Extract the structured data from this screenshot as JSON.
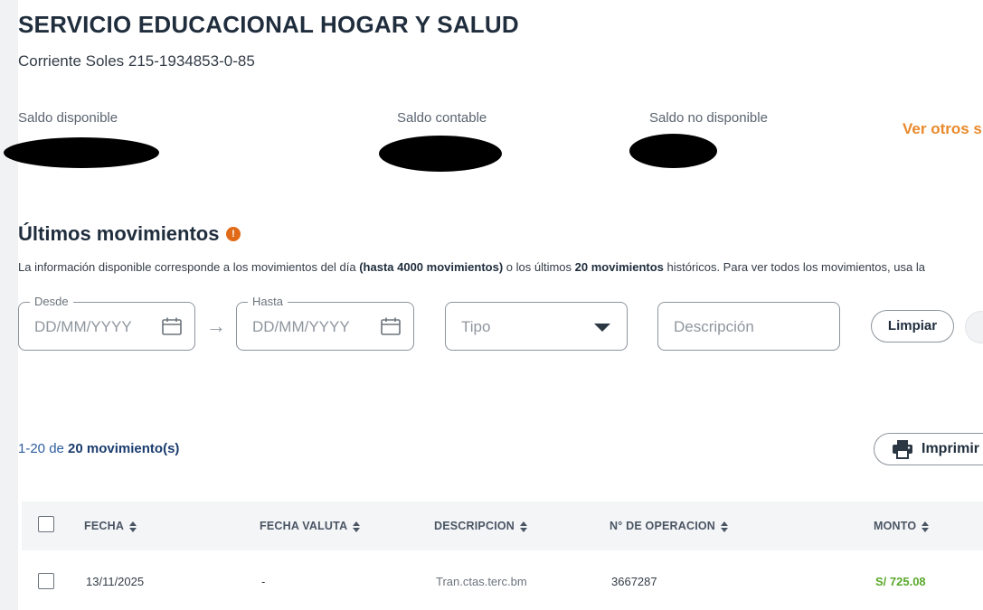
{
  "header": {
    "title": "SERVICIO EDUCACIONAL HOGAR Y SALUD",
    "account": "Corriente Soles 215-1934853-0-85"
  },
  "balances": {
    "available_label": "Saldo disponible",
    "accounting_label": "Saldo contable",
    "unavailable_label": "Saldo no disponible",
    "see_others": "Ver otros s"
  },
  "movements": {
    "title": "Últimos movimientos",
    "info_icon": "!",
    "info_text": {
      "part1": "La información disponible corresponde a los movimientos del día ",
      "bold1": "(hasta 4000 movimientos)",
      "part2": " o los últimos ",
      "bold2": "20 movimientos",
      "part3": " históricos. Para ver todos los movimientos, usa la"
    }
  },
  "filters": {
    "from_label": "Desde",
    "from_placeholder": "DD/MM/YYYY",
    "to_label": "Hasta",
    "to_placeholder": "DD/MM/YYYY",
    "arrow": "→",
    "type_placeholder": "Tipo",
    "description_placeholder": "Descripción",
    "clear_label": "Limpiar"
  },
  "results": {
    "range": "1-20 de ",
    "count": "20 movimiento(s)",
    "print_label": "Imprimir"
  },
  "table": {
    "columns": [
      "FECHA",
      "FECHA VALUTA",
      "DESCRIPCION",
      "N° DE OPERACION",
      "MONTO"
    ],
    "rows": [
      {
        "date": "13/11/2025",
        "value_date": "-",
        "description": "Tran.ctas.terc.bm",
        "operation": "3667287",
        "amount": "S/ 725.08"
      }
    ]
  },
  "colors": {
    "accent_orange": "#e8892b",
    "info_icon": "#e06a17",
    "amount_green": "#5aa92b",
    "link_blue": "#2d5d9f"
  }
}
